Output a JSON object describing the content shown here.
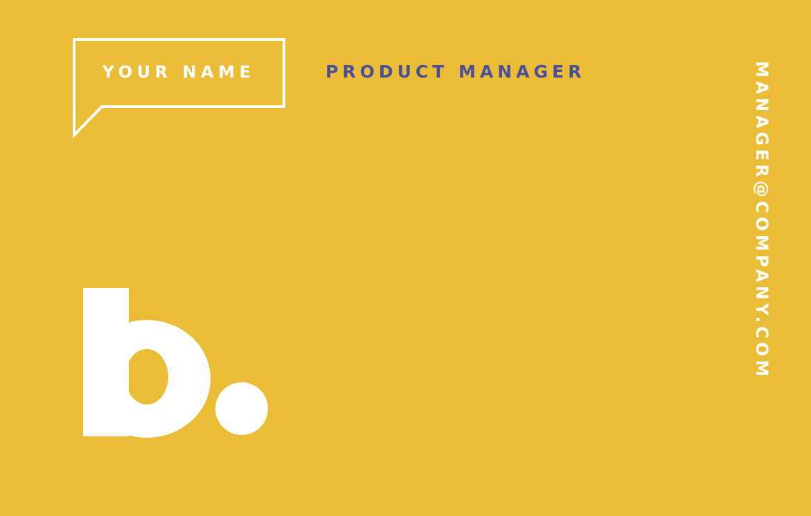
{
  "card": {
    "name": "YOUR NAME",
    "title": "PRODUCT MANAGER",
    "email": "MANAGER@COMPANY.COM",
    "logo_icon": "b-dot-logo-icon"
  },
  "colors": {
    "background": "#EBBD36",
    "accent": "#4A4F9A",
    "light": "#FFFFFF"
  }
}
